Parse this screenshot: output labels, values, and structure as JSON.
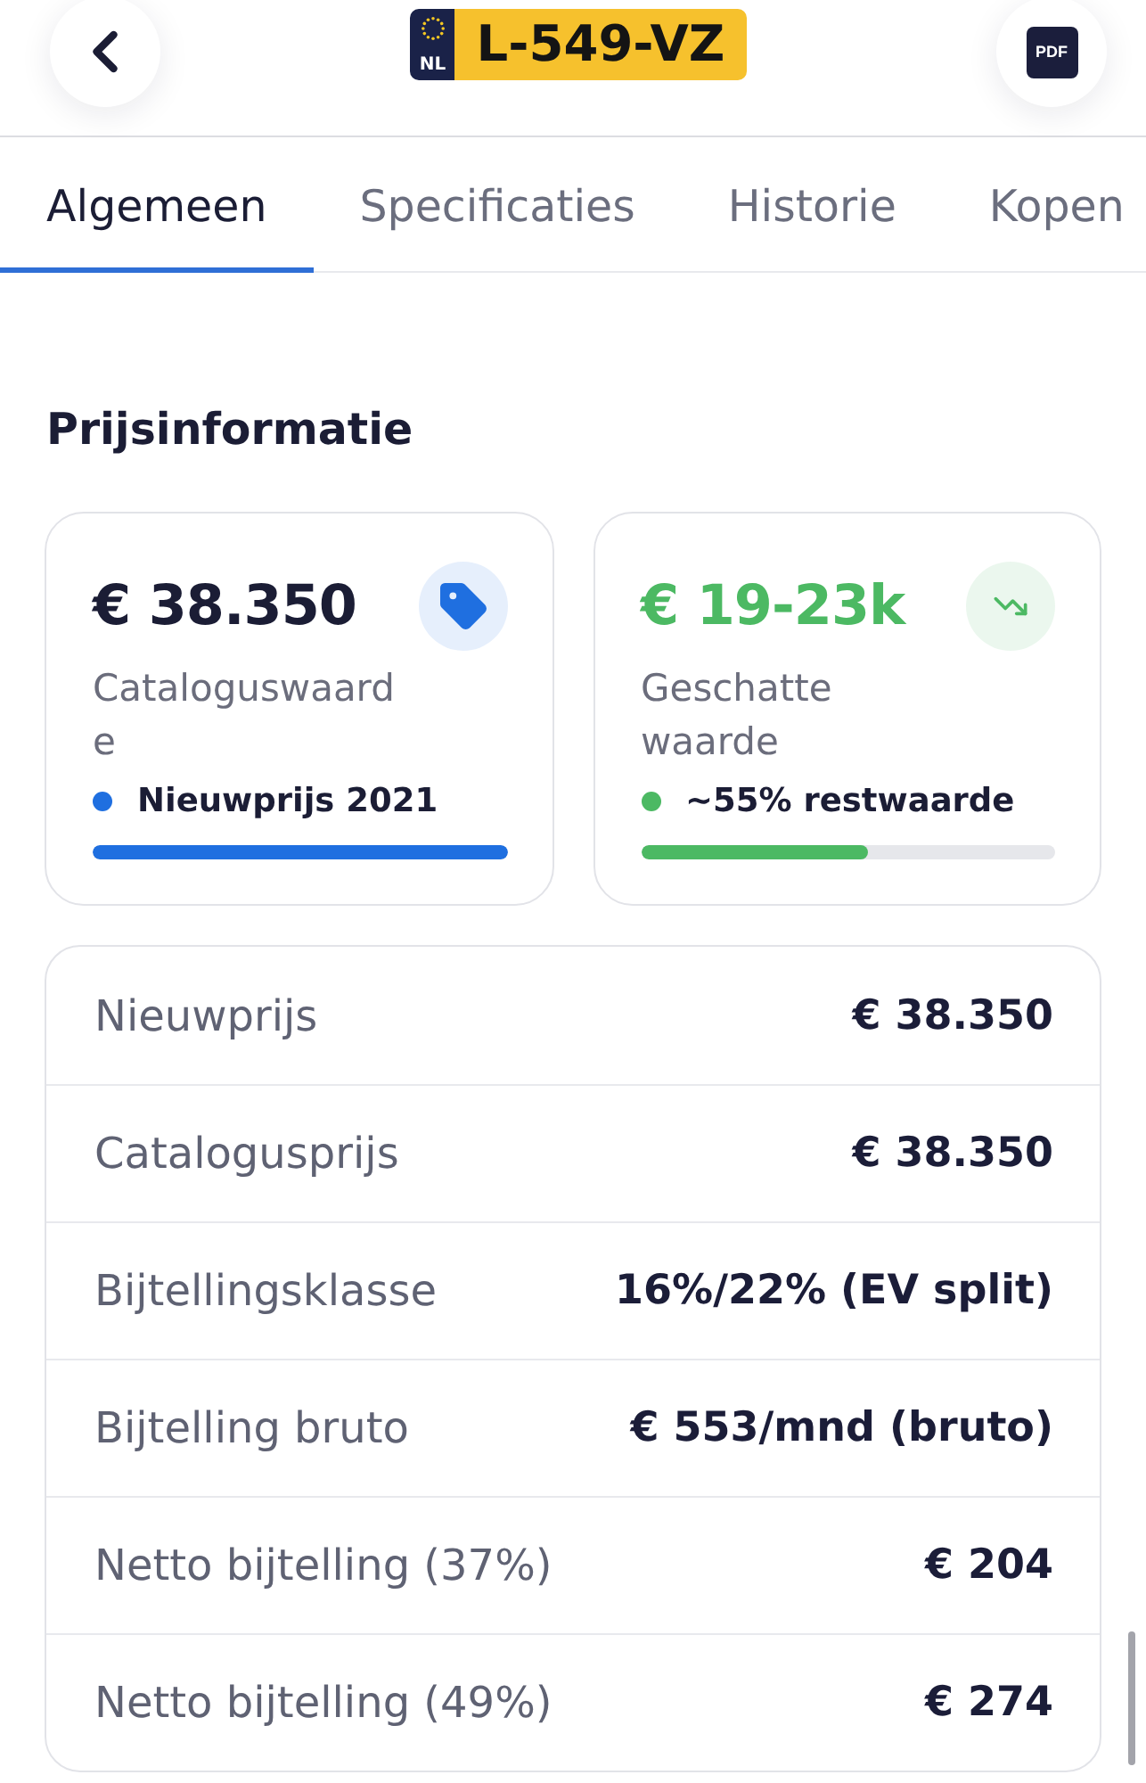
{
  "header": {
    "plate": {
      "country": "NL",
      "number": "L-549-VZ"
    },
    "pdf_button": {
      "label": "PDF"
    }
  },
  "tabs": [
    {
      "label": "Algemeen",
      "selected": true
    },
    {
      "label": "Specificaties",
      "selected": false
    },
    {
      "label": "Historie",
      "selected": false
    },
    {
      "label": "Kopen",
      "selected": false
    }
  ],
  "section_title": "Prijsinformatie",
  "summary_cards": [
    {
      "kind": "catalog",
      "value": "€ 38.350",
      "label": "Cataloguswaarde",
      "legend": "Nieuwprijs 2021",
      "color": "#1f6fe0",
      "level": 1
    },
    {
      "kind": "estimate",
      "value": "€ 19-23k",
      "label": "Geschatte waarde",
      "legend": "~55% restwaarde",
      "color": "#4cb963",
      "level": 0.55
    }
  ],
  "price_table": {
    "rows": [
      {
        "label": "Nieuwprijs",
        "value": "€ 38.350"
      },
      {
        "label": "Catalogusprijs",
        "value": "€ 38.350"
      },
      {
        "label": "Bijtellingsklasse",
        "value": "16%/22% (EV split)"
      },
      {
        "label": "Bijtelling bruto",
        "value": "€ 553/mnd (bruto)"
      },
      {
        "label": "Netto bijtelling (37%)",
        "value": "€ 204"
      },
      {
        "label": "Netto bijtelling (49%)",
        "value": "€ 274"
      }
    ]
  }
}
